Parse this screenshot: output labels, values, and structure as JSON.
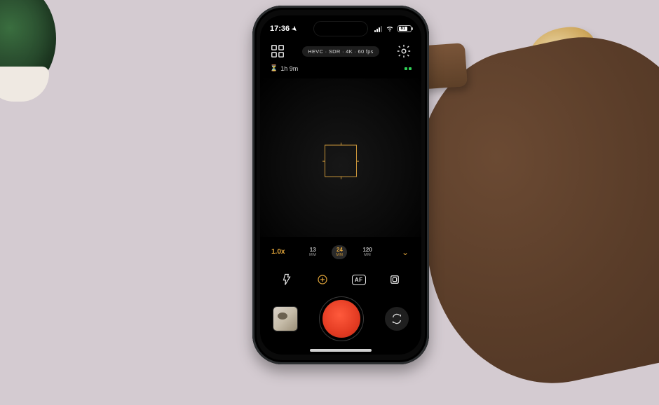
{
  "status": {
    "time": "17:36",
    "battery_pct": "81"
  },
  "appbar": {
    "format_pill": "HEVC · SDR · 4K · 60 fps"
  },
  "rec": {
    "remaining": "1h 9m"
  },
  "lens": {
    "zoom": "1.0x",
    "options": [
      {
        "num": "13",
        "mm": "MM"
      },
      {
        "num": "24",
        "mm": "MM"
      },
      {
        "num": "120",
        "mm": "MM"
      }
    ]
  },
  "tools": {
    "af_label": "AF"
  }
}
